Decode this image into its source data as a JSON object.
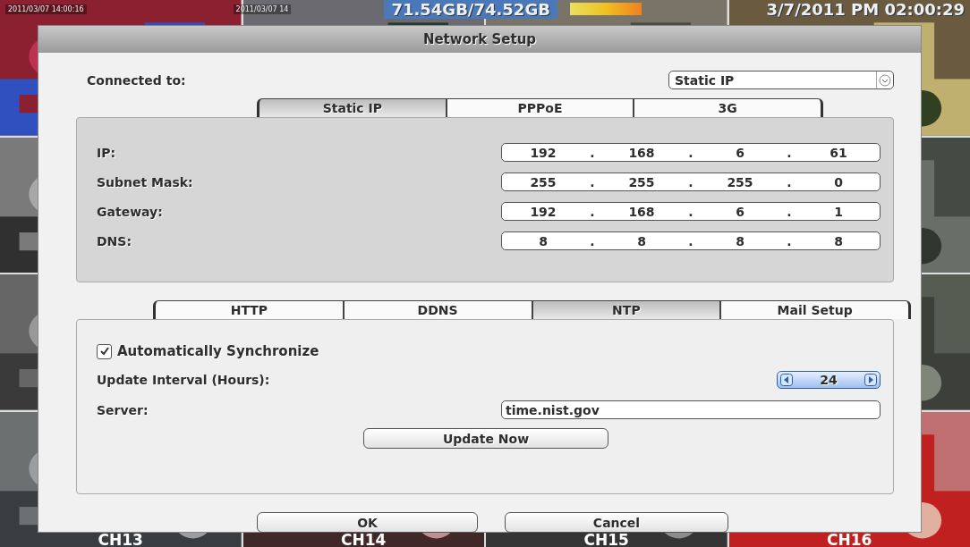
{
  "camera_view": {
    "status_bar": {
      "timestamps": [
        "2011/03/07 14:00:16",
        "2011/03/07 14"
      ],
      "disk_usage": "71.54GB/74.52GB",
      "clock": "3/7/2011 PM 02:00:29"
    },
    "channels": [
      "CH13",
      "CH14",
      "CH15",
      "CH16"
    ]
  },
  "dialog": {
    "title": "Network Setup",
    "connection": {
      "label": "Connected to:",
      "value": "Static IP"
    },
    "connection_tabs": [
      {
        "label": "Static IP",
        "selected": true
      },
      {
        "label": "PPPoE",
        "selected": false
      },
      {
        "label": "3G",
        "selected": false
      }
    ],
    "address_fields": [
      {
        "label": "IP:",
        "octets": [
          "192",
          "168",
          "6",
          "61"
        ]
      },
      {
        "label": "Subnet Mask:",
        "octets": [
          "255",
          "255",
          "255",
          "0"
        ]
      },
      {
        "label": "Gateway:",
        "octets": [
          "192",
          "168",
          "6",
          "1"
        ]
      },
      {
        "label": "DNS:",
        "octets": [
          "8",
          "8",
          "8",
          "8"
        ]
      }
    ],
    "separator": ".",
    "service_tabs": [
      {
        "label": "HTTP",
        "selected": false
      },
      {
        "label": "DDNS",
        "selected": false
      },
      {
        "label": "NTP",
        "selected": true
      },
      {
        "label": "Mail Setup",
        "selected": false
      }
    ],
    "ntp": {
      "auto_sync": {
        "label": "Automatically Synchronize",
        "checked": true
      },
      "interval": {
        "label": "Update Interval (Hours):",
        "value": "24"
      },
      "server": {
        "label": "Server:",
        "value": "time.nist.gov"
      },
      "update_button": "Update Now"
    },
    "buttons": [
      "OK",
      "Cancel"
    ]
  }
}
